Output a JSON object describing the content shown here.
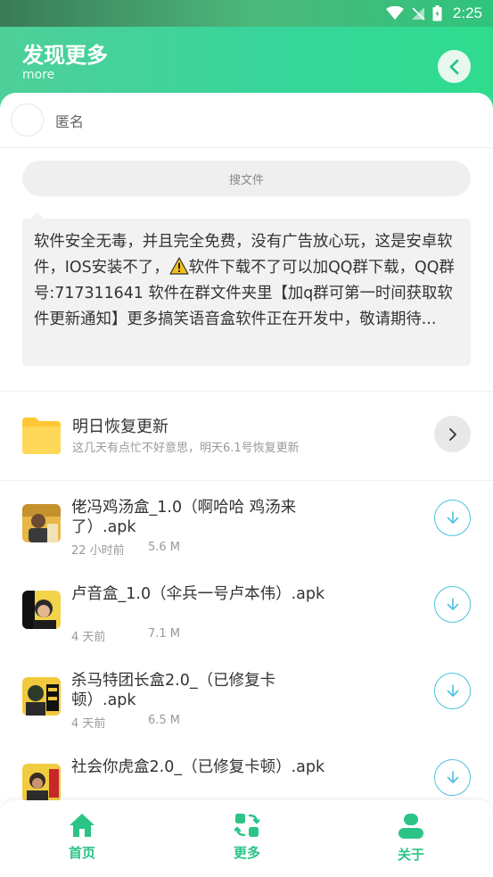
{
  "status_bar": {
    "time": "2:25"
  },
  "header": {
    "title": "发现更多",
    "subtitle": "more"
  },
  "user": {
    "name": "匿名"
  },
  "search": {
    "placeholder": "搜文件"
  },
  "notice": {
    "text_before_icon": "软件安全无毒，并且完全免费，没有广告放心玩，这是安卓软件，IOS安装不了，",
    "text_after_icon": "软件下载不了可以加QQ群下载，QQ群号:717311641 软件在群文件夹里【加q群可第一时间获取软件更新通知】更多搞笑语音盒软件正在开发中，敬请期待..."
  },
  "folder": {
    "title": "明日恢复更新",
    "subtitle": "这几天有点忙不好意思，明天6.1号恢复更新"
  },
  "files": [
    {
      "name": "佬冯鸡汤盒_1.0（啊哈哈 鸡汤来了）.apk",
      "time": "22 小时前",
      "size": "5.6 M"
    },
    {
      "name": "卢音盒_1.0（伞兵一号卢本伟）.apk",
      "time": "4 天前",
      "size": "7.1 M"
    },
    {
      "name": "杀马特团长盒2.0_（已修复卡顿）.apk",
      "time": "4 天前",
      "size": "6.5 M"
    },
    {
      "name": "社会你虎盒2.0_（已修复卡顿）.apk",
      "time": "",
      "size": ""
    }
  ],
  "tabs": [
    {
      "label": "首页",
      "icon": "home-icon"
    },
    {
      "label": "更多",
      "icon": "swap-icon"
    },
    {
      "label": "关于",
      "icon": "user-icon"
    }
  ],
  "colors": {
    "accent": "#2bc486",
    "download": "#4cc0e0",
    "folder": "#ffd54a"
  }
}
